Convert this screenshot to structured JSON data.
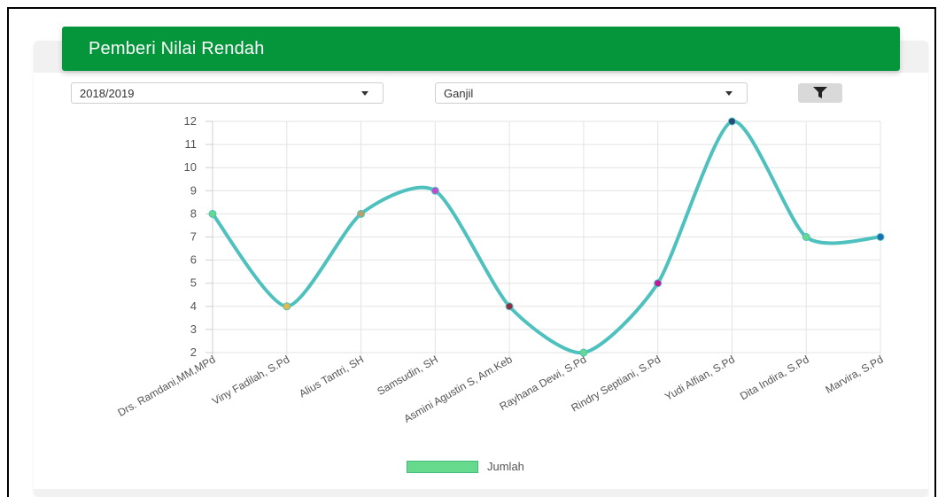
{
  "header": {
    "title": "Pemberi Nilai Rendah"
  },
  "filters": {
    "year": {
      "value": "2018/2019"
    },
    "semester": {
      "value": "Ganjil"
    }
  },
  "icons": {
    "filter": "filter-icon",
    "caret": "chevron-down-icon"
  },
  "colors": {
    "header_bg": "#05963c",
    "line": "#4ec1be",
    "legend": "#66d98c",
    "point_colors": [
      "#66d98c",
      "#e6b84a",
      "#b8a06a",
      "#c04ad0",
      "#8a3048",
      "#66d98c",
      "#c0189a",
      "#2a4a7a",
      "#66d98c",
      "#1b6fb0"
    ]
  },
  "chart_data": {
    "type": "line",
    "categories": [
      "Drs. Ramdani,MM,MPd",
      "Viny Fadilah, S.Pd",
      "Alius Tantri, SH",
      "Samsudin, SH",
      "Asmini Agustin S, Am.Keb",
      "Rayhana Dewi, S.Pd",
      "Rindry Septiani, S.Pd",
      "Yudi Alfian, S.Pd",
      "Dita Indira, S.Pd",
      "Marvira, S.Pd"
    ],
    "series": [
      {
        "name": "Jumlah",
        "values": [
          8,
          4,
          8,
          9,
          4,
          2,
          5,
          12,
          7,
          7
        ]
      }
    ],
    "ylim": [
      2,
      12
    ],
    "yticks": [
      "2",
      "3",
      "4",
      "5",
      "6",
      "7",
      "8",
      "9",
      "10",
      "11",
      "12"
    ],
    "grid": true,
    "legend": "bottom"
  }
}
